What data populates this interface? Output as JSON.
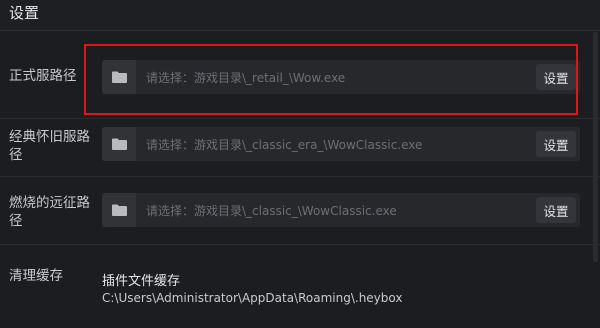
{
  "window": {
    "title": "设置"
  },
  "rows": [
    {
      "label": "正式服路径",
      "placeholder": "请选择：游戏目录\\_retail_\\Wow.exe",
      "button_label": "设置"
    },
    {
      "label": "经典怀旧服路径",
      "placeholder": "请选择：游戏目录\\_classic_era_\\WowClassic.exe",
      "button_label": "设置"
    },
    {
      "label": "燃烧的远征路径",
      "placeholder": "请选择：游戏目录\\_classic_\\WowClassic.exe",
      "button_label": "设置"
    }
  ],
  "cache": {
    "label": "清理缓存",
    "item_title": "插件文件缓存",
    "item_path": "C:\\Users\\Administrator\\AppData\\Roaming\\.heybox"
  },
  "icons": {
    "folder": "folder-icon"
  },
  "colors": {
    "highlight": "#e0141b"
  }
}
